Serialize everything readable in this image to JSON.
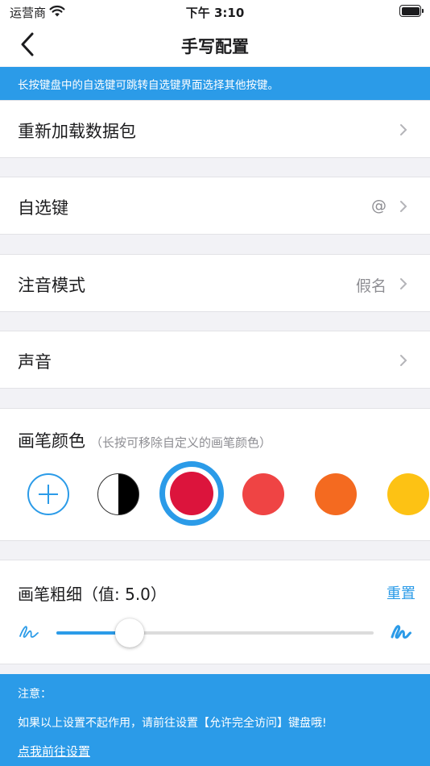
{
  "status_bar": {
    "carrier": "运营商",
    "time": "下午 3:10"
  },
  "nav": {
    "title": "手写配置"
  },
  "tip": "长按键盘中的自选键可跳转自选键界面选择其他按键。",
  "rows": [
    {
      "label": "重新加载数据包",
      "value": ""
    },
    {
      "label": "自选键",
      "value": "@"
    },
    {
      "label": "注音模式",
      "value": "假名"
    },
    {
      "label": "声音",
      "value": ""
    }
  ],
  "pen_color": {
    "title": "画笔颜色",
    "hint": "（长按可移除自定义的画笔颜色）",
    "swatches": [
      "add",
      "black-white",
      "#dc143c",
      "#ef4444",
      "#f46a20",
      "#fdc214"
    ],
    "selected": "#dc143c",
    "accent": "#2b9be8"
  },
  "pen_width": {
    "title": "画笔粗细（值: 5.0）",
    "reset_label": "重置",
    "value_fraction": 0.23
  },
  "notice": {
    "title": "注意：",
    "body": "如果以上设置不起作用，请前往设置【允许完全访问】键盘哦!",
    "link": "点我前往设置"
  }
}
